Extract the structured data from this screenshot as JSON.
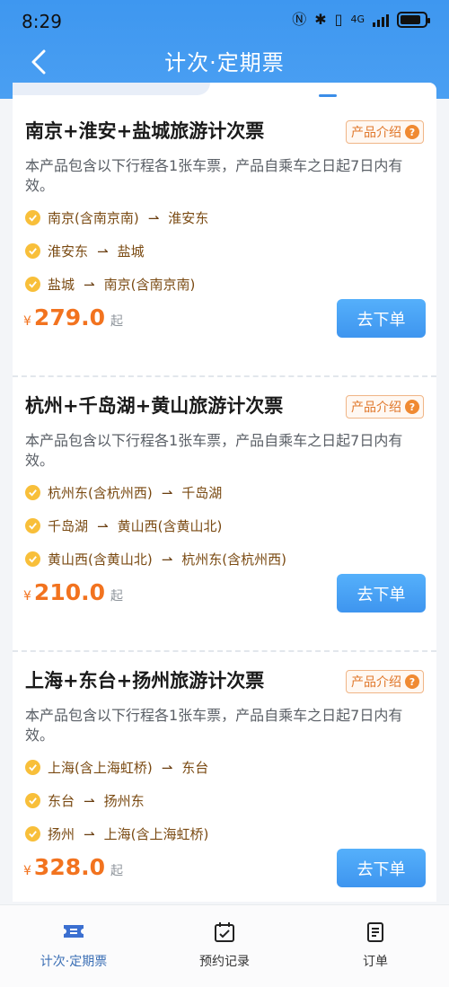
{
  "status_bar": {
    "time": "8:29",
    "icons": [
      "nfc-icon",
      "bluetooth-icon",
      "vibrate-icon",
      "4g-icon",
      "signal-icon",
      "battery-icon"
    ]
  },
  "header": {
    "title": "计次·定期票"
  },
  "colors": {
    "primary": "#3e97f0",
    "accent_orange": "#f2731f",
    "route_brown": "#7a4a12"
  },
  "products": [
    {
      "title": "南京+淮安+盐城旅游计次票",
      "intro_label": "产品介绍",
      "description": "本产品包含以下行程各1张车票，产品自乘车之日起7日内有效。",
      "routes": [
        {
          "from": "南京(含南京南)",
          "to": "淮安东"
        },
        {
          "from": "淮安东",
          "to": "盐城"
        },
        {
          "from": "盐城",
          "to": "南京(含南京南)"
        }
      ],
      "currency": "¥",
      "price": "279.0",
      "price_suffix": "起",
      "button": "去下单"
    },
    {
      "title": "杭州+千岛湖+黄山旅游计次票",
      "intro_label": "产品介绍",
      "description": "本产品包含以下行程各1张车票，产品自乘车之日起7日内有效。",
      "routes": [
        {
          "from": "杭州东(含杭州西)",
          "to": "千岛湖"
        },
        {
          "from": "千岛湖",
          "to": "黄山西(含黄山北)"
        },
        {
          "from": "黄山西(含黄山北)",
          "to": "杭州东(含杭州西)"
        }
      ],
      "currency": "¥",
      "price": "210.0",
      "price_suffix": "起",
      "button": "去下单"
    },
    {
      "title": "上海+东台+扬州旅游计次票",
      "intro_label": "产品介绍",
      "description": "本产品包含以下行程各1张车票，产品自乘车之日起7日内有效。",
      "routes": [
        {
          "from": "上海(含上海虹桥)",
          "to": "东台"
        },
        {
          "from": "东台",
          "to": "扬州东"
        },
        {
          "from": "扬州",
          "to": "上海(含上海虹桥)"
        }
      ],
      "currency": "¥",
      "price": "328.0",
      "price_suffix": "起",
      "button": "去下单"
    }
  ],
  "bottom_nav": [
    {
      "label": "计次·定期票",
      "icon": "ticket-icon",
      "active": true
    },
    {
      "label": "预约记录",
      "icon": "calendar-check-icon",
      "active": false
    },
    {
      "label": "订单",
      "icon": "order-list-icon",
      "active": false
    }
  ]
}
